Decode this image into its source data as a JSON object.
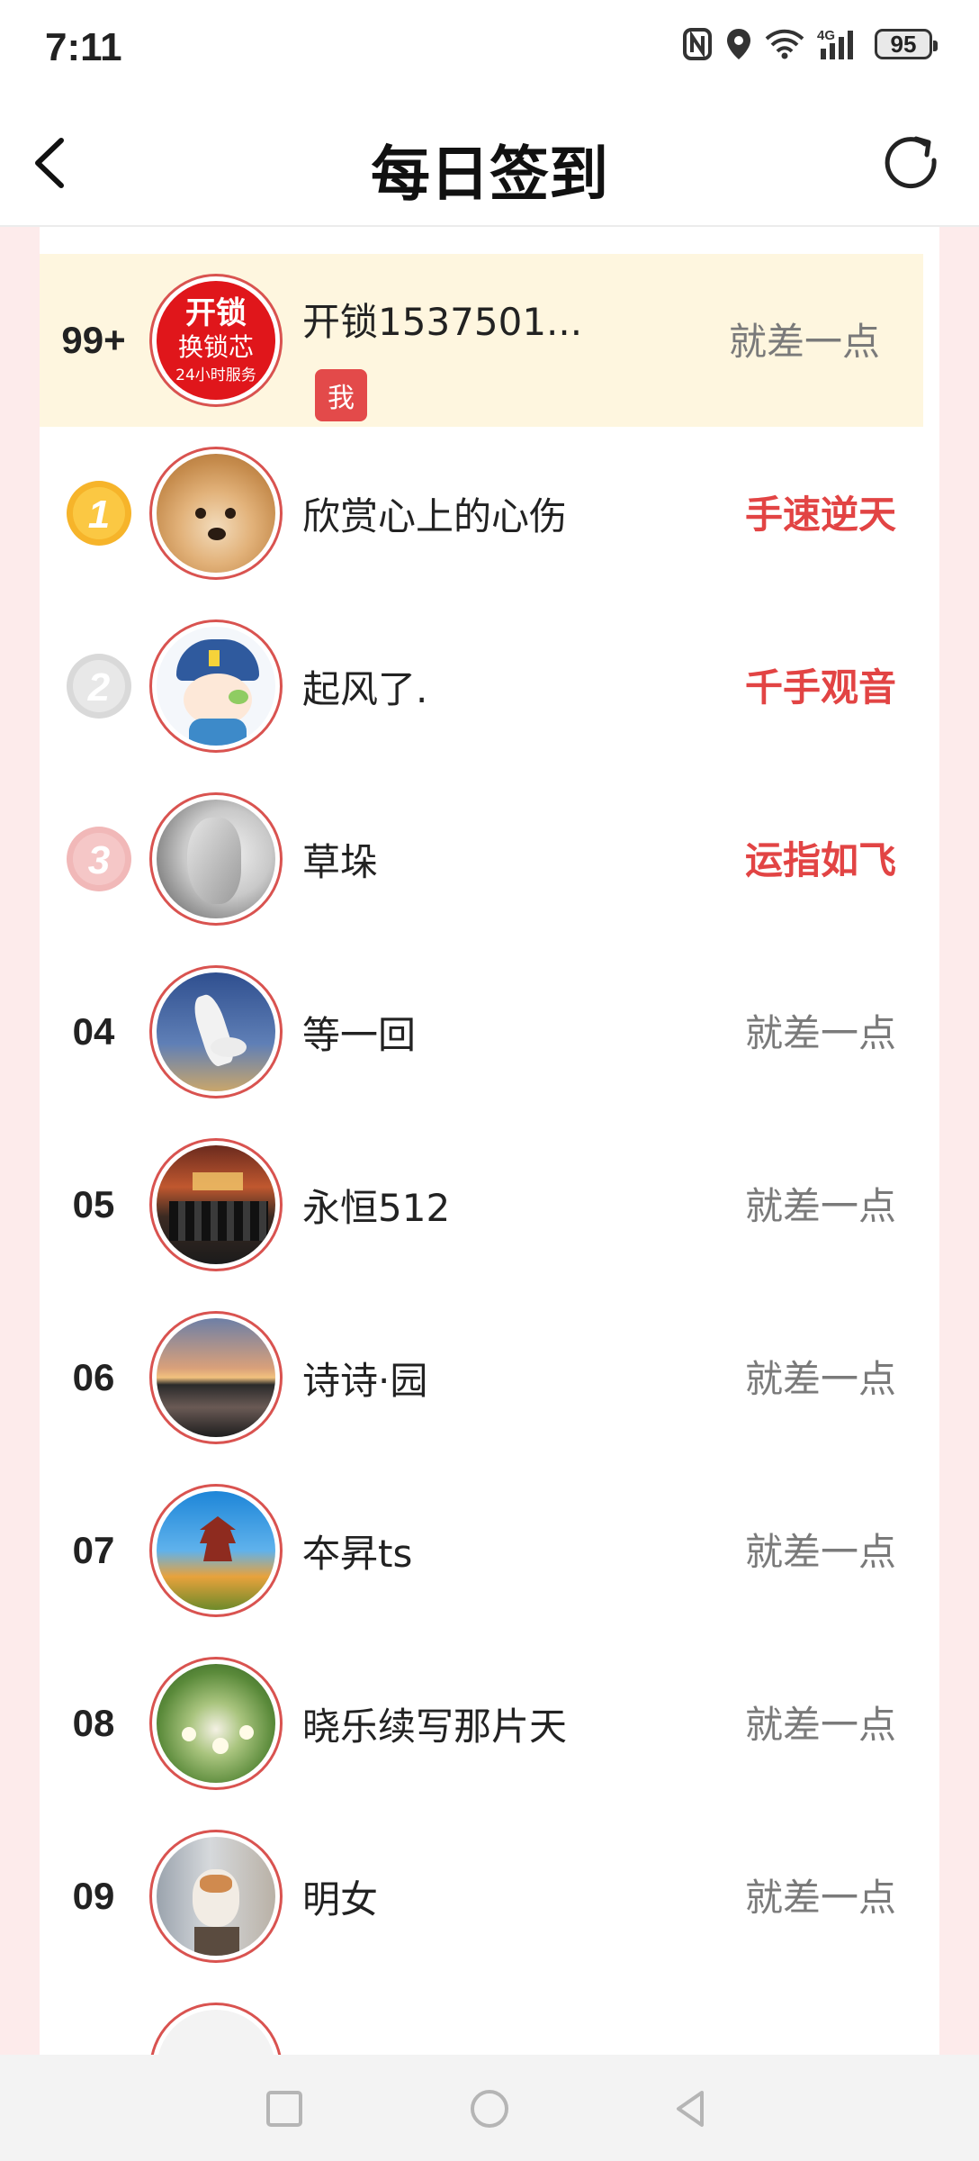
{
  "status_bar": {
    "time": "7:11",
    "network": "4G",
    "battery": "95",
    "icons": [
      "nfc-icon",
      "location-icon",
      "wifi-icon",
      "signal-icon",
      "battery-icon"
    ]
  },
  "header": {
    "title": "每日签到",
    "back_icon": "chevron-left-icon",
    "refresh_icon": "refresh-icon"
  },
  "colors": {
    "accent_red": "#e24444",
    "me_row_bg": "#fef6df",
    "page_bg_pink": "#fdebeb",
    "gold_medal": "#f6b42a",
    "silver_medal": "#d9d9d9",
    "bronze_medal": "#f1b8b8"
  },
  "rows": [
    {
      "rank": "99+",
      "name": "开锁1537501...",
      "status": "就差一点",
      "is_me": true,
      "me_label": "我",
      "avatar_text_1": "开锁",
      "avatar_text_2": "换锁芯",
      "avatar_text_3": "24小时服务"
    },
    {
      "rank": "1",
      "name": "欣赏心上的心伤",
      "status": "手速逆天",
      "medal": "gold"
    },
    {
      "rank": "2",
      "name": "起风了.",
      "status": "千手观音",
      "medal": "silver"
    },
    {
      "rank": "3",
      "name": "草垛",
      "status": "运指如飞",
      "medal": "bronze"
    },
    {
      "rank": "04",
      "name": "等一回",
      "status": "就差一点"
    },
    {
      "rank": "05",
      "name": "永恒512",
      "status": "就差一点"
    },
    {
      "rank": "06",
      "name": "诗诗·园",
      "status": "就差一点"
    },
    {
      "rank": "07",
      "name": "夲昇ts",
      "status": "就差一点"
    },
    {
      "rank": "08",
      "name": "晓乐续写那片天",
      "status": "就差一点"
    },
    {
      "rank": "09",
      "name": "明女",
      "status": "就差一点"
    }
  ],
  "nav": {
    "icons": [
      "recents-square-icon",
      "home-circle-icon",
      "back-triangle-icon"
    ]
  }
}
